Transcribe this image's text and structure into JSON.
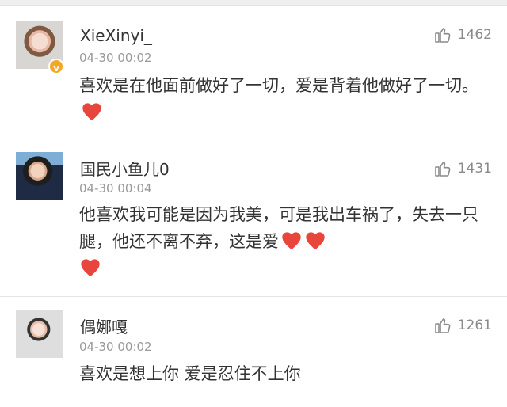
{
  "comments": [
    {
      "username": "XieXinyi_",
      "time": "04-30 00:02",
      "likes": "1462",
      "verified": true,
      "text": "喜欢是在他面前做好了一切，爱是背着他做好了一切。",
      "hearts": 1
    },
    {
      "username": "国民小鱼儿0",
      "time": "04-30 00:04",
      "likes": "1431",
      "verified": false,
      "text": "他喜欢我可能是因为我美，可是我出车祸了，失去一只腿，他还不离不弃，这是爱",
      "hearts": 3
    },
    {
      "username": "偶娜嘎",
      "time": "04-30 00:02",
      "likes": "1261",
      "verified": false,
      "text": "喜欢是想上你 爱是忍住不上你",
      "hearts": 0
    }
  ],
  "colors": {
    "heart": "#e8453c",
    "verify_badge": "#f5a623",
    "muted": "#999999"
  },
  "icons": {
    "like": "thumbs-up-icon",
    "heart": "heart-icon",
    "verified": "verified-badge-icon"
  }
}
